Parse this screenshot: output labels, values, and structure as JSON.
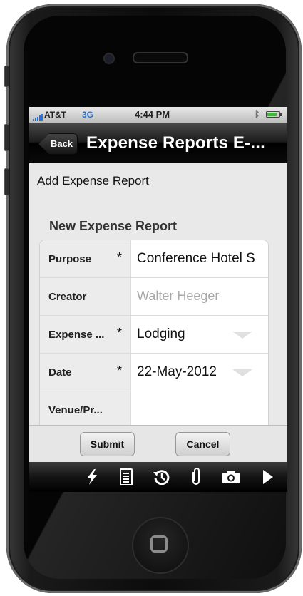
{
  "status_bar": {
    "carrier": "AT&T",
    "network": "3G",
    "time": "4:44 PM",
    "bluetooth_icon": "bluetooth-icon",
    "battery_level": 0.8,
    "signal_bars": 5
  },
  "nav": {
    "back_label": "Back",
    "title": "Expense Reports E-..."
  },
  "page": {
    "heading": "Add Expense Report",
    "section_title": "New Expense Report"
  },
  "form": {
    "rows": [
      {
        "label": "Purpose",
        "required": "*",
        "value": "Conference Hotel S",
        "placeholder": ""
      },
      {
        "label": "Creator",
        "required": "",
        "value": "",
        "placeholder": "Walter Heeger"
      },
      {
        "label": "Expense ...",
        "required": "*",
        "value": "Lodging",
        "placeholder": ""
      },
      {
        "label": "Date",
        "required": "*",
        "value": "22-May-2012",
        "placeholder": ""
      },
      {
        "label": "Venue/Pr...",
        "required": "",
        "value": "",
        "placeholder": ""
      }
    ]
  },
  "actions": {
    "submit_label": "Submit",
    "cancel_label": "Cancel"
  },
  "toolbar": {
    "icons": [
      "lightning-icon",
      "document-icon",
      "history-icon",
      "paperclip-icon",
      "camera-icon",
      "play-icon"
    ]
  },
  "colors": {
    "network": "#2a6fd6",
    "battery": "#43b53a",
    "nav_bar": "#000000"
  }
}
